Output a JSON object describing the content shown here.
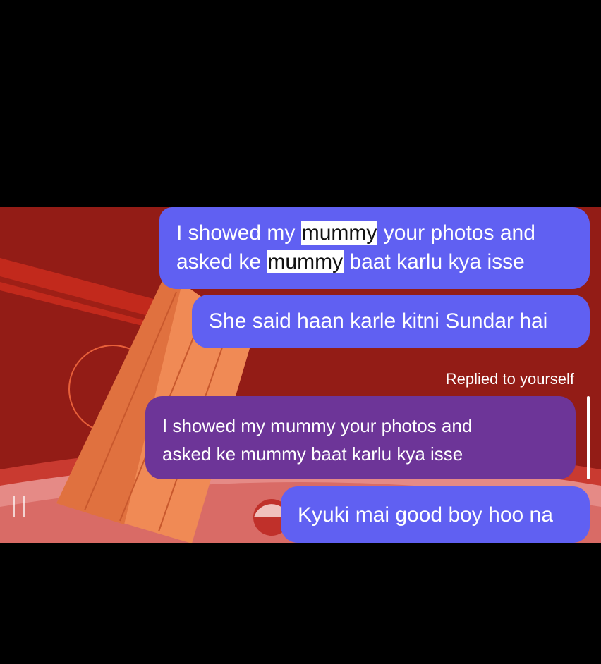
{
  "conversation": {
    "messages": [
      {
        "parts": [
          {
            "text": "I showed my ",
            "highlight": false
          },
          {
            "text": "mummy",
            "highlight": true
          },
          {
            "text": " your photos and",
            "highlight": false
          },
          {
            "text": "asked ke ",
            "highlight": false
          },
          {
            "text": "mummy",
            "highlight": true
          },
          {
            "text": " baat karlu kya isse",
            "highlight": false
          }
        ]
      },
      {
        "text": "She said haan karle kitni Sundar hai"
      },
      {
        "reply_caption": "Replied to yourself",
        "quoted_line1": "I showed my mummy your photos and",
        "quoted_line2": "asked ke mummy baat karlu kya isse"
      },
      {
        "text": "Kyuki mai good boy hoo na"
      }
    ]
  },
  "colors": {
    "sent_bubble": "#6060f2",
    "quoted_bubble": "#6d3598",
    "highlight": "#ffffff",
    "wallpaper_bg": "#8c1a14"
  }
}
